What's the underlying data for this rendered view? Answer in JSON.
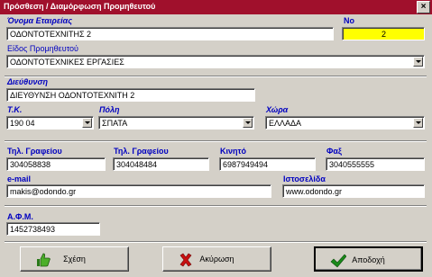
{
  "window": {
    "title": "Πρόσθεση / Διαμόρφωση Προμηθευτού"
  },
  "form": {
    "company_name": {
      "label": "Όνομα Εταιρείας",
      "value": "ΟΔΟΝΤΟΤΕΧΝΙΤΗΣ 2"
    },
    "number": {
      "label": "Νο",
      "value": "2"
    },
    "supplier_type": {
      "label": "Είδος Προμηθευτού",
      "value": "ΟΔΟΝΤΟΤΕΧΝΙΚΕΣ ΕΡΓΑΣΙΕΣ"
    },
    "address": {
      "label": "Διεύθυνση",
      "value": "ΔΙΕΥΘΥΝΣΗ ΟΔΟΝΤΟΤΕΧΝΙΤΗ 2"
    },
    "postal_code": {
      "label": "Τ.Κ.",
      "value": "190 04"
    },
    "city": {
      "label": "Πόλη",
      "value": "ΣΠΑΤΑ"
    },
    "country": {
      "label": "Χώρα",
      "value": "ΕΛΛΑΔΑ"
    },
    "office_phone_1": {
      "label": "Τηλ. Γραφείου",
      "value": "304058838"
    },
    "office_phone_2": {
      "label": "Τηλ. Γραφείου",
      "value": "304048484"
    },
    "mobile": {
      "label": "Κινητό",
      "value": "6987949494"
    },
    "fax": {
      "label": "Φαξ",
      "value": "3040555555"
    },
    "email": {
      "label": "e-mail",
      "value": "makis@odondo.gr"
    },
    "website": {
      "label": "Ιστοσελίδα",
      "value": "www.odondo.gr"
    },
    "tax_id": {
      "label": "Α.Φ.Μ.",
      "value": "1452738493"
    }
  },
  "buttons": {
    "relation": {
      "label": "Σχέση",
      "icon": "thumbs-up-icon"
    },
    "cancel": {
      "label": "Ακύρωση",
      "icon": "red-x-icon"
    },
    "accept": {
      "label": "Αποδοχή",
      "icon": "green-check-icon"
    }
  },
  "colors": {
    "titlebar": "#a0102c",
    "label": "#0000c0",
    "number_bg": "#ffff00"
  }
}
